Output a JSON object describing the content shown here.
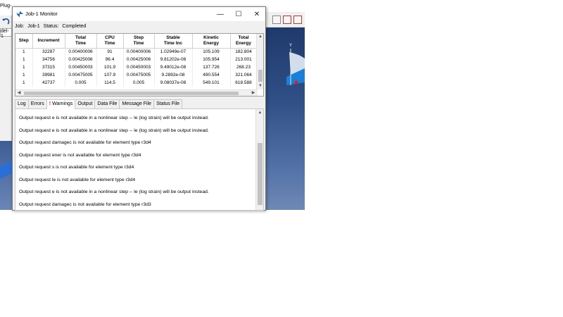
{
  "background": {
    "menu_fragment": "Plug-",
    "model_tab_fragment": "del-1"
  },
  "dialog": {
    "title": "Job-1 Monitor",
    "job_label": "Job:",
    "job_value": "Job-1",
    "status_label": "Status:",
    "status_value": "Completed",
    "window_buttons": {
      "minimize": "—",
      "maximize": "☐",
      "close": "✕"
    }
  },
  "table": {
    "headers": [
      "Step",
      "Increment",
      "Total\nTime",
      "CPU\nTime",
      "Step\nTime",
      "Stable\nTime Inc",
      "Kinetic\nEnergy",
      "Total\nEnergy"
    ],
    "rows": [
      [
        "1",
        "32287",
        "0.00400006",
        "91",
        "0.00400006",
        "1.02949e-07",
        "105.109",
        "182.804"
      ],
      [
        "1",
        "34756",
        "0.00425006",
        "96.4",
        "0.00425006",
        "9.81202e-08",
        "105.954",
        "213.001"
      ],
      [
        "1",
        "37315",
        "0.00450003",
        "101.9",
        "0.00450003",
        "9.49012e-08",
        "137.726",
        "268.23"
      ],
      [
        "1",
        "39981",
        "0.00475005",
        "107.9",
        "0.00475005",
        "9.2892e-08",
        "490.554",
        "321.064"
      ],
      [
        "1",
        "42737",
        "0.005",
        "114.5",
        "0.005",
        "9.08037e-08",
        "549.101",
        "618.588"
      ]
    ]
  },
  "tabs": [
    {
      "label": "Log",
      "active": false,
      "warning": false
    },
    {
      "label": "Errors",
      "active": false,
      "warning": false
    },
    {
      "label": "Warnings",
      "active": true,
      "warning": true
    },
    {
      "label": "Output",
      "active": false,
      "warning": false
    },
    {
      "label": "Data File",
      "active": false,
      "warning": false
    },
    {
      "label": "Message File",
      "active": false,
      "warning": false
    },
    {
      "label": "Status File",
      "active": false,
      "warning": false
    }
  ],
  "warning_marker": "!",
  "warnings": [
    "Output request e is not available in a nonlinear step -- le (log strain) will be output instead.",
    "Output request e is not available in a nonlinear step -- le (log strain) will be output instead.",
    "Output request damagec is not available for element type r3d4",
    "Output request ener is not available for element type r3d4",
    "Output request s is not available for element type r3d4",
    "Output request le is not available for element type r3d4",
    "Output request e is not available in a nonlinear step -- le (log strain) will be output instead.",
    "Output request damagec is not available for element type r3d3"
  ],
  "colors": {
    "warning_red": "#d21e1e",
    "viewport_blue": "#304f86"
  }
}
